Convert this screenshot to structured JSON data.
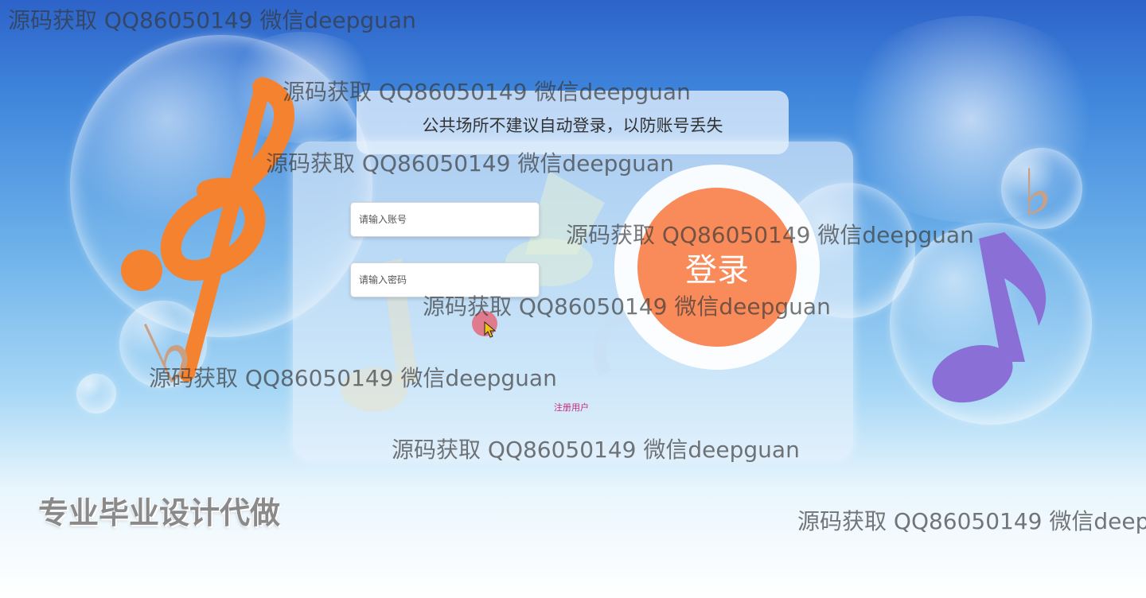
{
  "hint": "公共场所不建议自动登录，以防账号丢失",
  "form": {
    "account_placeholder": "请输入账号",
    "password_placeholder": "请输入密码",
    "login_label": "登录",
    "register_label": "注册用户"
  },
  "ad_text": "专业毕业设计代做",
  "watermark": "源码获取 QQ86050149 微信deepguan",
  "colors": {
    "login_button": "#f98b5b",
    "register_link": "#c8287a",
    "sky_top": "#2d63c9"
  }
}
